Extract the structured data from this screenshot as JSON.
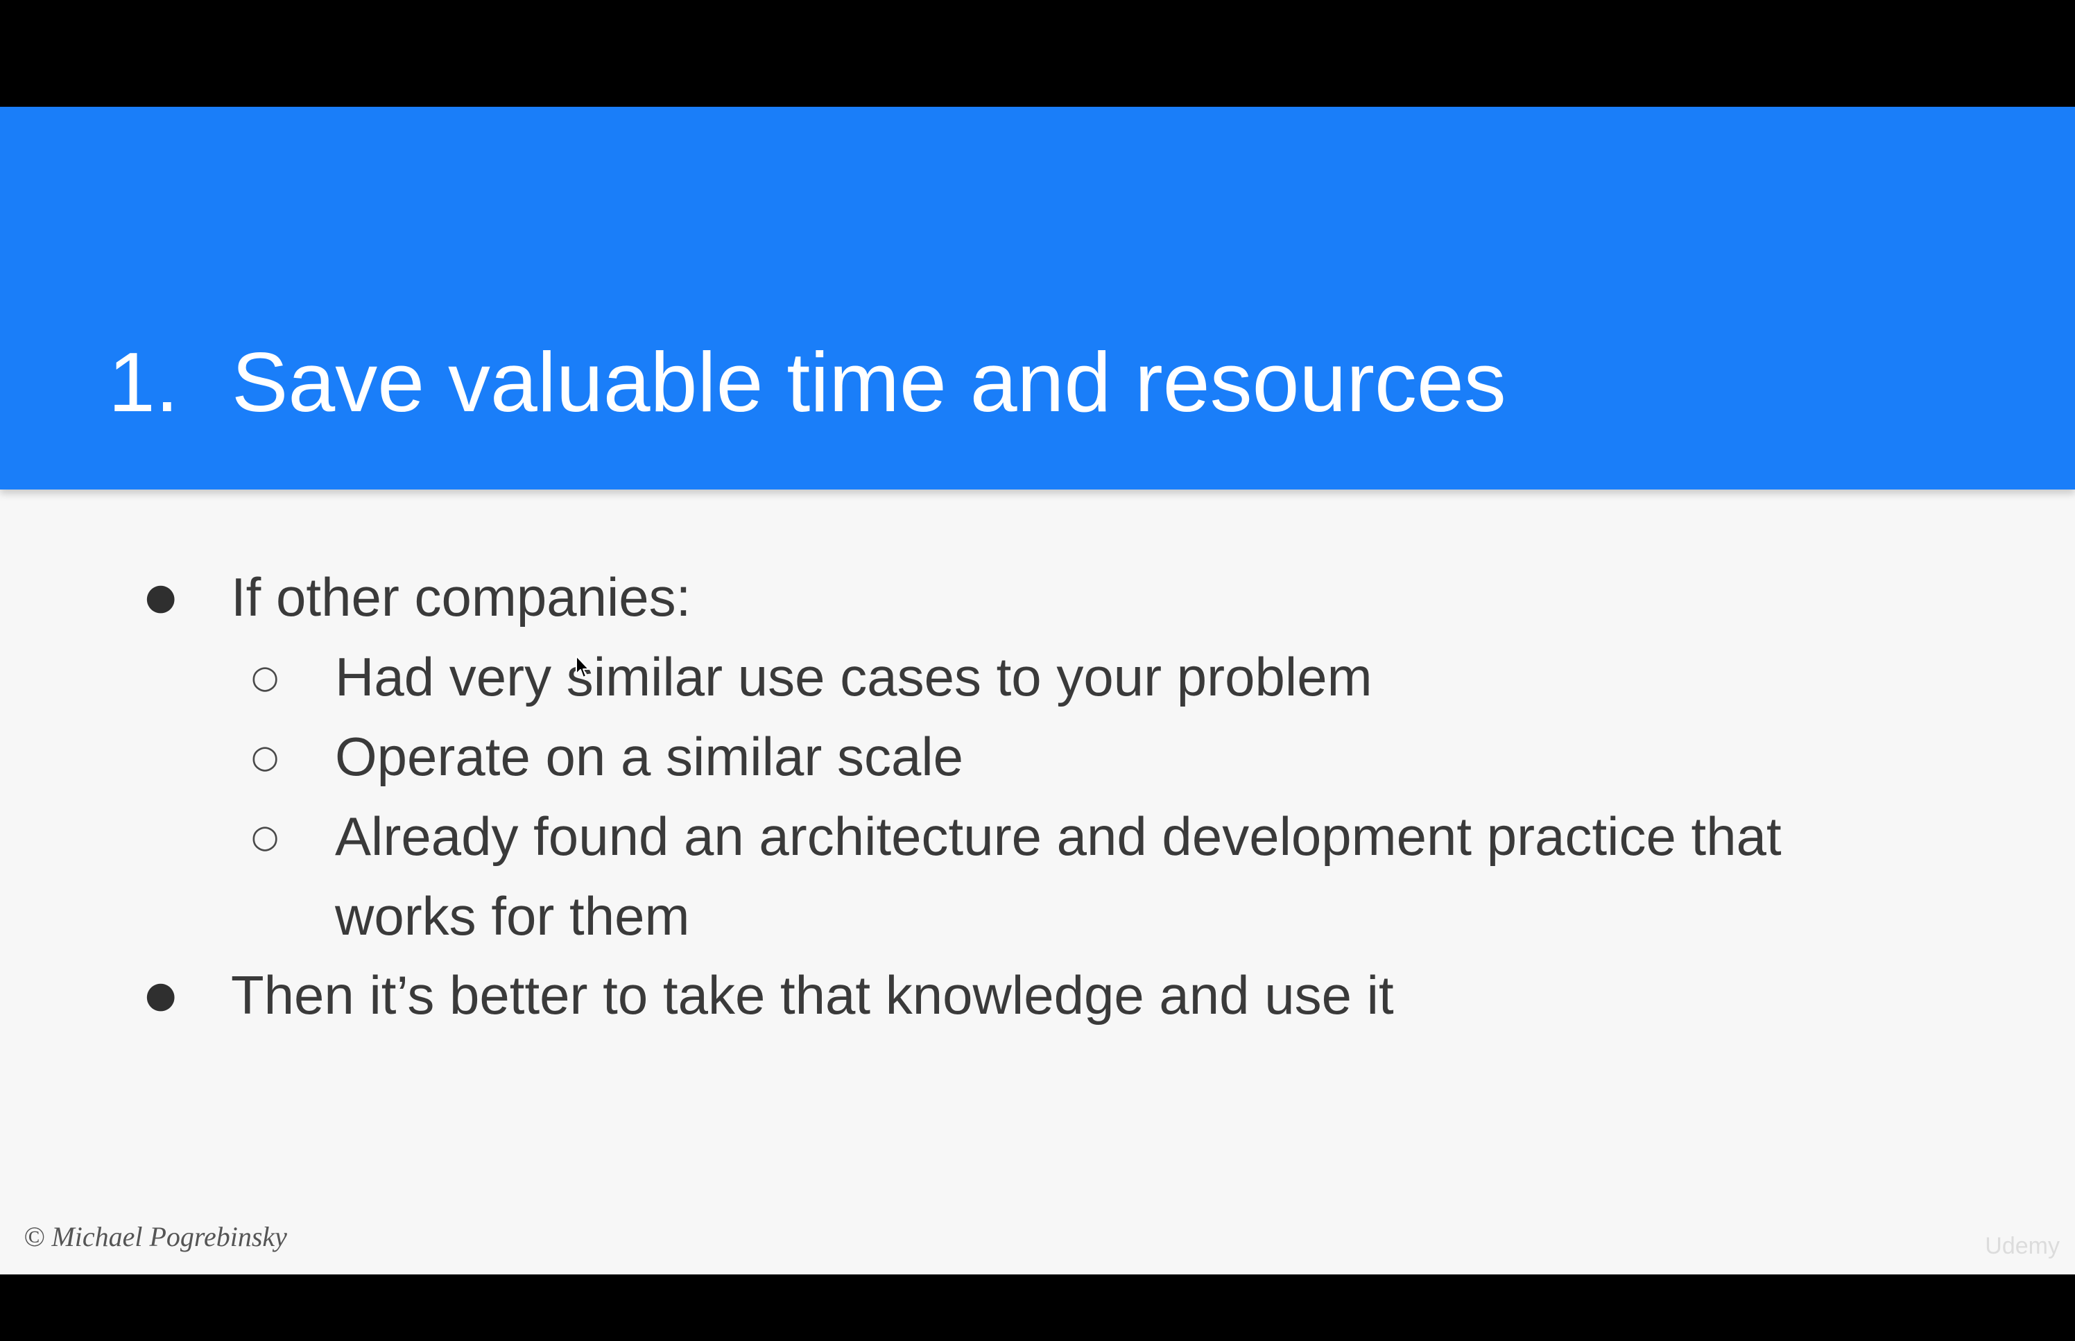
{
  "slide": {
    "title_number": "1.",
    "title_text": "Save valuable time and resources",
    "bullets": [
      {
        "level": 1,
        "text": "If other companies:"
      },
      {
        "level": 2,
        "text": "Had very similar use cases to your problem"
      },
      {
        "level": 2,
        "text": "Operate on a similar scale"
      },
      {
        "level": 2,
        "text": "Already found an architecture and development practice that"
      },
      {
        "level": 2,
        "text": "works for them",
        "continuation": true
      },
      {
        "level": 1,
        "text": "Then it’s better to take that knowledge and use it"
      }
    ],
    "bullet_glyphs": {
      "level1": "●",
      "level2": "○"
    },
    "footer_copyright": "© Michael Pogrebinsky",
    "watermark": "Udemy"
  },
  "colors": {
    "title_band": "#1a7ef9",
    "slide_background": "#f7f7f7",
    "letterbox": "#000000",
    "title_text": "#ffffff",
    "body_text": "#3a3a3a"
  },
  "icons": {
    "pointer": "mouse-pointer-icon"
  }
}
